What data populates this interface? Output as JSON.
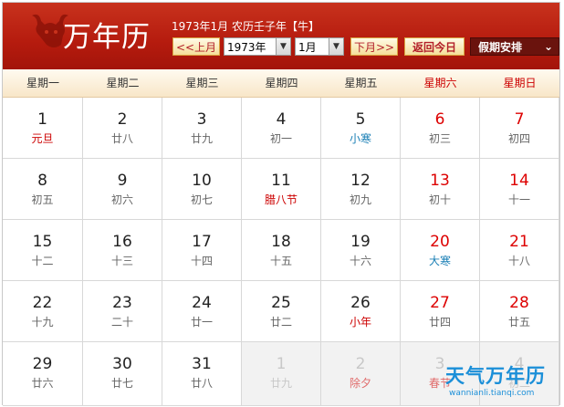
{
  "header": {
    "title": "万年历",
    "date_line": "1973年1月 农历壬子年【牛】",
    "prev_month": "<<上月",
    "year_select": "1973年",
    "month_select": "1月",
    "next_month": "下月>>",
    "today": "返回今日",
    "holiday": "假期安排",
    "holiday_caret": "⌄",
    "select_arrow": "▼"
  },
  "weekdays": [
    "星期一",
    "星期二",
    "星期三",
    "星期四",
    "星期五",
    "星期六",
    "星期日"
  ],
  "days": [
    {
      "d": "1",
      "l": "元旦",
      "t": "festival"
    },
    {
      "d": "2",
      "l": "廿八",
      "t": ""
    },
    {
      "d": "3",
      "l": "廿九",
      "t": ""
    },
    {
      "d": "4",
      "l": "初一",
      "t": ""
    },
    {
      "d": "5",
      "l": "小寒",
      "t": "term"
    },
    {
      "d": "6",
      "l": "初三",
      "t": ""
    },
    {
      "d": "7",
      "l": "初四",
      "t": ""
    },
    {
      "d": "8",
      "l": "初五",
      "t": ""
    },
    {
      "d": "9",
      "l": "初六",
      "t": ""
    },
    {
      "d": "10",
      "l": "初七",
      "t": ""
    },
    {
      "d": "11",
      "l": "腊八节",
      "t": "festival"
    },
    {
      "d": "12",
      "l": "初九",
      "t": ""
    },
    {
      "d": "13",
      "l": "初十",
      "t": ""
    },
    {
      "d": "14",
      "l": "十一",
      "t": ""
    },
    {
      "d": "15",
      "l": "十二",
      "t": ""
    },
    {
      "d": "16",
      "l": "十三",
      "t": ""
    },
    {
      "d": "17",
      "l": "十四",
      "t": ""
    },
    {
      "d": "18",
      "l": "十五",
      "t": ""
    },
    {
      "d": "19",
      "l": "十六",
      "t": ""
    },
    {
      "d": "20",
      "l": "大寒",
      "t": "term"
    },
    {
      "d": "21",
      "l": "十八",
      "t": ""
    },
    {
      "d": "22",
      "l": "十九",
      "t": ""
    },
    {
      "d": "23",
      "l": "二十",
      "t": ""
    },
    {
      "d": "24",
      "l": "廿一",
      "t": ""
    },
    {
      "d": "25",
      "l": "廿二",
      "t": ""
    },
    {
      "d": "26",
      "l": "小年",
      "t": "festival"
    },
    {
      "d": "27",
      "l": "廿四",
      "t": ""
    },
    {
      "d": "28",
      "l": "廿五",
      "t": ""
    },
    {
      "d": "29",
      "l": "廿六",
      "t": ""
    },
    {
      "d": "30",
      "l": "廿七",
      "t": ""
    },
    {
      "d": "31",
      "l": "廿八",
      "t": ""
    },
    {
      "d": "1",
      "l": "廿九",
      "t": "",
      "other": true
    },
    {
      "d": "2",
      "l": "除夕",
      "t": "festival",
      "other": true
    },
    {
      "d": "3",
      "l": "春节",
      "t": "festival",
      "other": true
    },
    {
      "d": "4",
      "l": "初二",
      "t": "",
      "other": true
    }
  ],
  "watermark": {
    "text": "天气万年历",
    "url": "wannianli.tianqi.com"
  },
  "colors": {
    "header_red": "#b51b0e",
    "weekend_red": "#dd0000",
    "term_blue": "#1a7fb5"
  }
}
